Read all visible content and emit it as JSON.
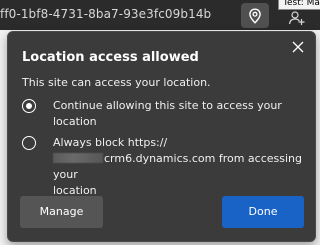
{
  "browser": {
    "url_fragment": "ff0-1bf8-4731-8ba7-93e3fc09b14b",
    "tooltip": "Test: Ma"
  },
  "popup": {
    "title": "Location access allowed",
    "subtitle": "This site can access your location.",
    "options": [
      {
        "label": "Continue allowing this site to access your location",
        "selected": true
      },
      {
        "label_line1": "Always block https://",
        "label_domain": "crm6.dynamics.com from accessing your",
        "label_line3": "location",
        "selected": false
      }
    ],
    "manage_label": "Manage",
    "done_label": "Done"
  },
  "colors": {
    "popup_background": "#3b3b3b",
    "done_button": "#1a63c6",
    "manage_button": "#555555"
  },
  "icons": [
    "location-pin-icon",
    "user-add-icon",
    "close-icon"
  ]
}
